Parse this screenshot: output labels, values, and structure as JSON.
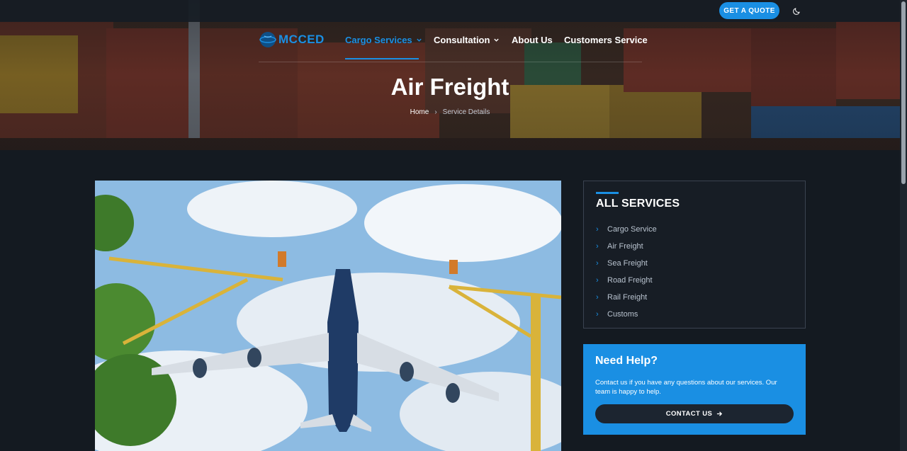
{
  "topbar": {
    "quote_label": "GET A QUOTE"
  },
  "logo": {
    "text": "MCCED"
  },
  "nav": {
    "items": [
      {
        "label": "Cargo Services",
        "has_dropdown": true,
        "active": true
      },
      {
        "label": "Consultation",
        "has_dropdown": true,
        "active": false
      },
      {
        "label": "About Us",
        "has_dropdown": false,
        "active": false
      },
      {
        "label": "Customers Service",
        "has_dropdown": false,
        "active": false
      }
    ]
  },
  "hero": {
    "title": "Air Freight",
    "breadcrumb": {
      "home": "Home",
      "separator": "›",
      "current": "Service Details"
    }
  },
  "sidebar": {
    "services_title": "ALL SERVICES",
    "services": [
      {
        "label": "Cargo Service"
      },
      {
        "label": "Air Freight"
      },
      {
        "label": "Sea Freight"
      },
      {
        "label": "Road Freight"
      },
      {
        "label": "Rail Freight"
      },
      {
        "label": "Customs"
      }
    ],
    "help": {
      "title": "Need Help?",
      "text": "Contact us if you have any questions about our services. Our team is happy to help.",
      "button_label": "CONTACT US",
      "button_icon": "arrow-right-icon"
    }
  },
  "colors": {
    "accent": "#1a8fe3",
    "background": "#141a21",
    "panel": "#171d25"
  }
}
